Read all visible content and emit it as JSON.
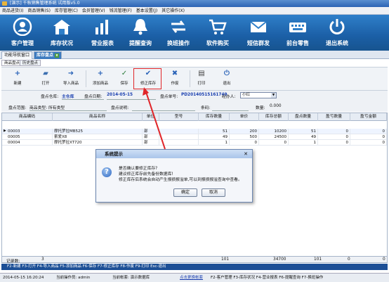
{
  "window": {
    "title": "[演示] 千秋销售管理系统 试用版v5.0"
  },
  "menu": [
    "商品进货(I)",
    "商品销售(S)",
    "库存管理(C)",
    "会员管理(V)",
    "钱流管理(F)",
    "基本设置(J)",
    "其它操作(X)"
  ],
  "bigbar": [
    {
      "label": "客户管理",
      "icon": "user-icon"
    },
    {
      "label": "库存状况",
      "icon": "warehouse-icon"
    },
    {
      "label": "营业报表",
      "icon": "report-icon"
    },
    {
      "label": "提醒查询",
      "icon": "bell-icon"
    },
    {
      "label": "换班操作",
      "icon": "swap-icon"
    },
    {
      "label": "软件购买",
      "icon": "cart-icon"
    },
    {
      "label": "短信群发",
      "icon": "mail-icon"
    },
    {
      "label": "前台零售",
      "icon": "keyboard-icon"
    },
    {
      "label": "退出系统",
      "icon": "power-icon"
    }
  ],
  "tabs": {
    "nav": "功能导航窗口",
    "active": "库存盘点"
  },
  "subtabs": [
    "商品盘点",
    "历史盘点"
  ],
  "toolbar": [
    {
      "label": "新建",
      "icon": "plus-icon",
      "glyph": "+"
    },
    {
      "label": "打开",
      "icon": "folder-icon",
      "glyph": "▰"
    },
    {
      "label": "导入商品",
      "icon": "import-icon",
      "glyph": "➜"
    },
    {
      "label": "添加商品",
      "icon": "add-item-icon",
      "glyph": "+"
    },
    {
      "label": "保存",
      "icon": "save-icon",
      "glyph": "✓"
    },
    {
      "label": "修正库存",
      "icon": "check-icon",
      "glyph": "✔"
    },
    {
      "label": "作废",
      "icon": "x-icon",
      "glyph": "✖"
    },
    {
      "label": "打印",
      "icon": "printer-icon",
      "glyph": "▤"
    },
    {
      "label": "退出",
      "icon": "exit-icon",
      "glyph": "⏻"
    }
  ],
  "form": {
    "warehouse_label": "盘点仓库:",
    "warehouse": "主仓库",
    "date_label": "盘点日期:",
    "date": "2014-05-15",
    "order_label": "盘点单号:",
    "order": "PD20140515161749",
    "agent_label": "经办人:",
    "agent": "小红",
    "range_label": "盘点范围:",
    "range": "商品类型: 所有类型",
    "desc_label": "盘点说明:",
    "barcode_label": "条码:",
    "qty_label": "数量:",
    "qty": "0.000"
  },
  "table": {
    "headers": [
      "商品编码",
      "商品名称",
      "单位",
      "型号",
      "库存数量",
      "单价",
      "库存总额",
      "盘点数量",
      "盈亏数量",
      "盈亏金额"
    ],
    "rows": [
      [
        "00003",
        "摩托罗拉MB525",
        "部",
        "",
        "51",
        "200",
        "10200",
        "51",
        "0",
        "0"
      ],
      [
        "00005",
        "索爱X8",
        "部",
        "",
        "49",
        "500",
        "24500",
        "49",
        "0",
        "0"
      ],
      [
        "00004",
        "摩托罗拉XT720",
        "部",
        "",
        "1",
        "0",
        "0",
        "1",
        "0",
        "0"
      ]
    ],
    "footer": {
      "label": "记录数:",
      "count": "3",
      "stock": "101",
      "total": "34700",
      "check": "101",
      "pl_qty": "0",
      "pl_amt": "0"
    }
  },
  "hotkeys": "F2-新建 F3-打开 F4-导入商品 F5-添加商品 F6-保存 F7-修正库存 F8-作废 F9-打印 Esc-退出",
  "status": {
    "time": "2014-05-15 16:20:24",
    "operator": "当前操作员: admin",
    "account": "当前帐套: 演示数据库",
    "link": "点击更换帐套",
    "shortcuts": "F2-客户管理  F3-库存状况  F4-营业报表  F6-提醒查询  F7-换班操作"
  },
  "dialog": {
    "title": "系统提示",
    "lines": [
      "是否确认要修正库存?",
      "建议修正库存前先备份数据库!",
      "修正库存后系统会自动产生报损报溢单,可以到报损报溢查询中查看。"
    ],
    "ok": "确定",
    "cancel": "取消"
  },
  "colors": {
    "accent": "#1b5fa6",
    "highlight": "#e0262a"
  }
}
